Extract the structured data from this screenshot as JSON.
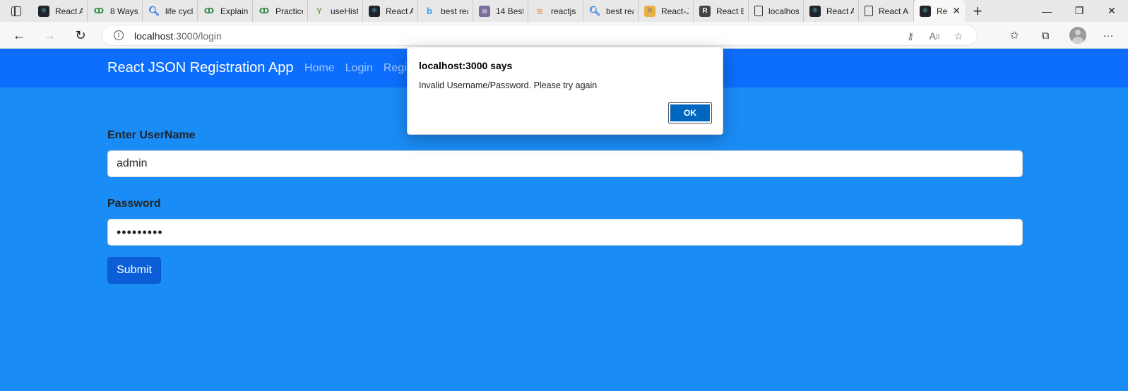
{
  "browser": {
    "tabs": [
      {
        "label": "React A",
        "icon": "react-icon"
      },
      {
        "label": "8 Ways",
        "icon": "gfg-icon"
      },
      {
        "label": "life cycle",
        "icon": "search-icon"
      },
      {
        "label": "Explain",
        "icon": "gfg-icon"
      },
      {
        "label": "Practice",
        "icon": "gfg-icon"
      },
      {
        "label": "useHisto",
        "icon": "ycombinator-icon"
      },
      {
        "label": "React A",
        "icon": "react-icon"
      },
      {
        "label": "best rea",
        "icon": "bing-icon"
      },
      {
        "label": "14 Best",
        "icon": "course-icon"
      },
      {
        "label": "reactjs",
        "icon": "soundwave-icon"
      },
      {
        "label": "best rea",
        "icon": "search-icon"
      },
      {
        "label": "React-JS",
        "icon": "reactjs-icon"
      },
      {
        "label": "React Bo",
        "icon": "r-logo-icon"
      },
      {
        "label": "localhost",
        "icon": "document-icon"
      },
      {
        "label": "React A",
        "icon": "react-icon"
      },
      {
        "label": "React A",
        "icon": "document-icon"
      }
    ],
    "active_tab": {
      "label": "Rea",
      "icon": "react-icon"
    },
    "url_host": "localhost",
    "url_path": ":3000/login"
  },
  "navbar": {
    "brand": "React JSON Registration App",
    "links": [
      "Home",
      "Login",
      "Regi"
    ]
  },
  "form": {
    "username_label": "Enter UserName",
    "username_value": "admin",
    "password_label": "Password",
    "password_value": "•••••••••",
    "submit_label": "Submit"
  },
  "dialog": {
    "title": "localhost:3000 says",
    "message": "Invalid Username/Password. Please try again",
    "ok_label": "OK"
  },
  "colors": {
    "page_bg": "#1a8cf6",
    "navbar_bg": "#0d6efd",
    "submit_bg": "#0b5ed7",
    "dialog_ok_bg": "#0067c0"
  }
}
